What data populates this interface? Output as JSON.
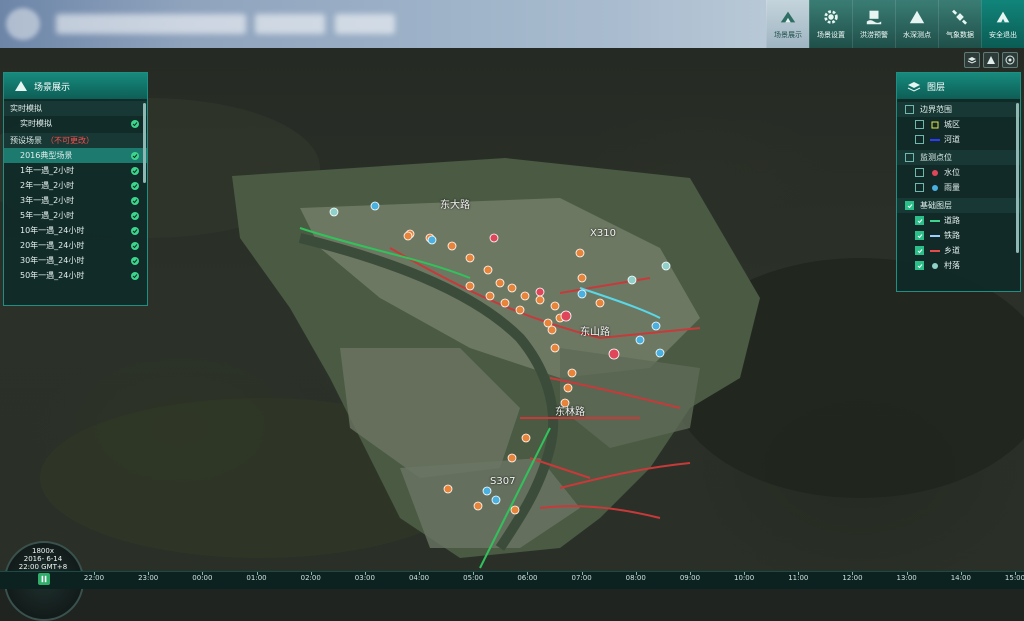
{
  "header": {
    "nav": [
      {
        "label": "场景展示",
        "icon": "mountain-icon",
        "active": true
      },
      {
        "label": "场景设置",
        "icon": "gear-icon",
        "active": false
      },
      {
        "label": "洪涝预警",
        "icon": "flood-icon",
        "active": false
      },
      {
        "label": "水深测点",
        "icon": "peak-icon",
        "active": false
      },
      {
        "label": "气象数据",
        "icon": "satellite-icon",
        "active": false
      },
      {
        "label": "安全退出",
        "icon": "exit-icon",
        "active": false
      }
    ]
  },
  "tools": [
    "layers-icon",
    "terrain-icon",
    "compass-icon"
  ],
  "scene_panel": {
    "title": "场景展示",
    "section_realtime": "实时模拟",
    "realtime_item": "实时模拟",
    "section_preset": "预设场景",
    "preset_warning": "（不可更改）",
    "presets": [
      {
        "label": "2016典型场景",
        "selected": true
      },
      {
        "label": "1年一遇_2小时",
        "selected": false
      },
      {
        "label": "2年一遇_2小时",
        "selected": false
      },
      {
        "label": "3年一遇_2小时",
        "selected": false
      },
      {
        "label": "5年一遇_2小时",
        "selected": false
      },
      {
        "label": "10年一遇_24小时",
        "selected": false
      },
      {
        "label": "20年一遇_24小时",
        "selected": false
      },
      {
        "label": "30年一遇_24小时",
        "selected": false
      },
      {
        "label": "50年一遇_24小时",
        "selected": false
      }
    ]
  },
  "layer_panel": {
    "title": "图层",
    "groups": [
      {
        "label": "边界范围",
        "checked": false,
        "items": [
          {
            "label": "城区",
            "checked": false,
            "swatch": "#e8e84a",
            "shape": "square"
          },
          {
            "label": "河道",
            "checked": false,
            "swatch": "#2c3cff",
            "shape": "bar"
          }
        ]
      },
      {
        "label": "监测点位",
        "checked": false,
        "items": [
          {
            "label": "水位",
            "checked": false,
            "swatch": "#e0465a",
            "shape": "pin"
          },
          {
            "label": "雨量",
            "checked": false,
            "swatch": "#4ab0e0",
            "shape": "pin"
          }
        ]
      },
      {
        "label": "基础图层",
        "checked": true,
        "items": [
          {
            "label": "道路",
            "checked": true,
            "swatch": "#3dd68c",
            "shape": "bar"
          },
          {
            "label": "铁路",
            "checked": true,
            "swatch": "#9ad0ff",
            "shape": "bar"
          },
          {
            "label": "乡道",
            "checked": true,
            "swatch": "#e64a4a",
            "shape": "bar"
          },
          {
            "label": "村落",
            "checked": true,
            "swatch": "#8fd0c8",
            "shape": "pin"
          }
        ]
      }
    ]
  },
  "map_labels": [
    "X310",
    "S307",
    "东林路",
    "东山路",
    "东大路"
  ],
  "clock": {
    "scale": "1800x",
    "date": "2016- 6-14",
    "time": "22:00 GMT+8"
  },
  "timeline": {
    "ticks": [
      "22:00",
      "23:00",
      "00:00",
      "01:00",
      "02:00",
      "03:00",
      "04:00",
      "05:00",
      "06:00",
      "07:00",
      "08:00",
      "09:00",
      "10:00",
      "11:00",
      "12:00",
      "13:00",
      "14:00",
      "15:00"
    ]
  },
  "colors": {
    "accent": "#178a7d",
    "panel_bg": "#0e2a28",
    "check": "#3bd68c",
    "warning": "#ff4a4a"
  }
}
